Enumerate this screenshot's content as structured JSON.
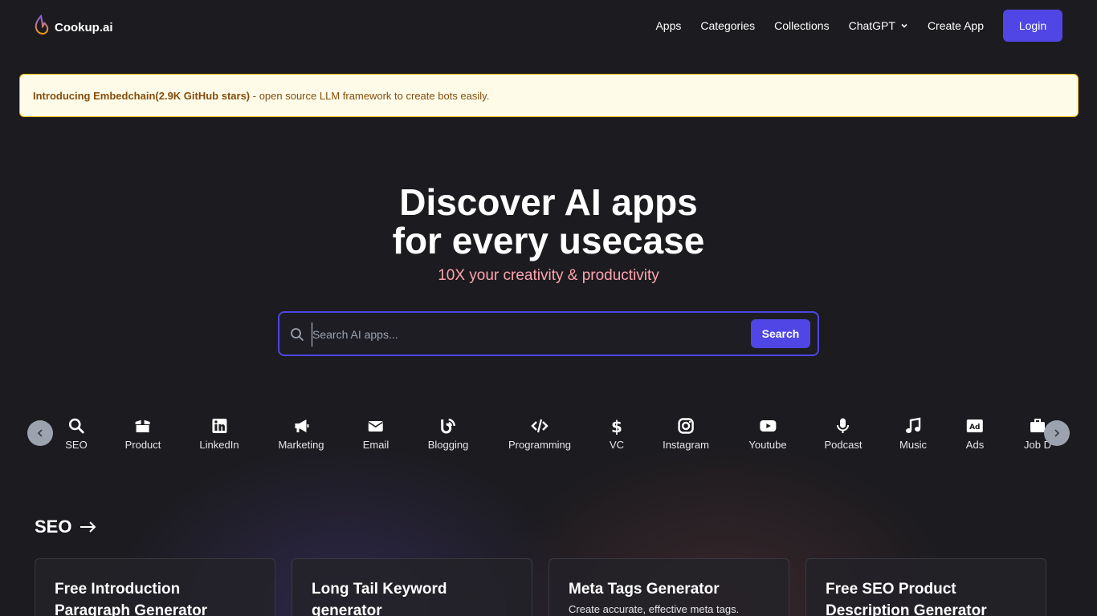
{
  "header": {
    "logo_text": "Cookup.ai",
    "nav": [
      {
        "label": "Apps"
      },
      {
        "label": "Categories"
      },
      {
        "label": "Collections"
      },
      {
        "label": "ChatGPT"
      },
      {
        "label": "Create App"
      }
    ],
    "login_label": "Login"
  },
  "banner": {
    "bold_text": "Introducing Embedchain(2.9K GitHub stars)",
    "rest_text": " - open source LLM framework to create bots easily."
  },
  "hero": {
    "title_line1": "Discover AI apps",
    "title_line2": "for every usecase",
    "subtitle": "10X your creativity & productivity"
  },
  "search": {
    "placeholder": "Search AI apps...",
    "button_label": "Search"
  },
  "categories": [
    {
      "label": "SEO",
      "icon": "search-icon"
    },
    {
      "label": "Product",
      "icon": "box-icon"
    },
    {
      "label": "LinkedIn",
      "icon": "linkedin-icon"
    },
    {
      "label": "Marketing",
      "icon": "megaphone-icon"
    },
    {
      "label": "Email",
      "icon": "envelope-icon"
    },
    {
      "label": "Blogging",
      "icon": "blog-icon"
    },
    {
      "label": "Programming",
      "icon": "code-icon"
    },
    {
      "label": "VC",
      "icon": "dollar-icon"
    },
    {
      "label": "Instagram",
      "icon": "instagram-icon"
    },
    {
      "label": "Youtube",
      "icon": "youtube-icon"
    },
    {
      "label": "Podcast",
      "icon": "microphone-icon"
    },
    {
      "label": "Music",
      "icon": "music-icon"
    },
    {
      "label": "Ads",
      "icon": "ad-icon"
    },
    {
      "label": "Job D",
      "icon": "briefcase-icon"
    }
  ],
  "section": {
    "title": "SEO",
    "cards": [
      {
        "title": "Free Introduction Paragraph Generator",
        "desc": ""
      },
      {
        "title": "Long Tail Keyword generator",
        "desc": ""
      },
      {
        "title": "Meta Tags Generator",
        "desc": "Create accurate, effective meta tags."
      },
      {
        "title": "Free SEO Product Description Generator",
        "desc": ""
      }
    ]
  },
  "colors": {
    "background": "#1c1b1f",
    "accent": "#4f46e5",
    "subtitle": "#fda4af",
    "banner_bg": "#fefce8",
    "banner_text": "#854d0e"
  }
}
